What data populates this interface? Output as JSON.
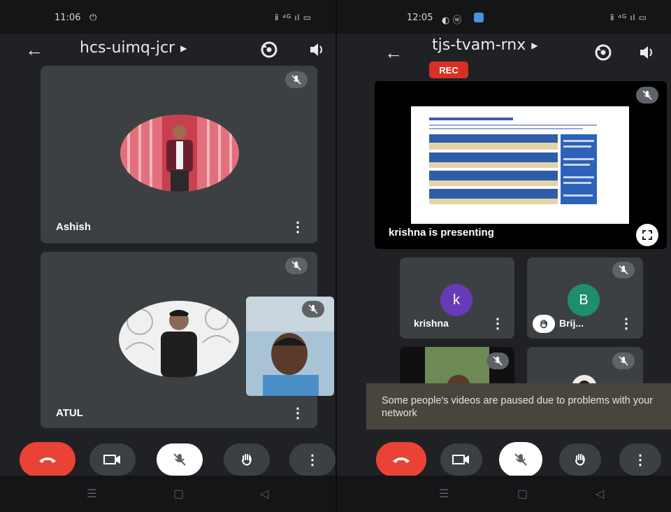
{
  "left": {
    "status": {
      "time": "11:06",
      "indicators": "⏻",
      "signal": "ⅱ ⁴ᴳ ıl ▭"
    },
    "meeting_code": "hcs-uimq-jcr",
    "participants": [
      {
        "name": "Ashish"
      },
      {
        "name": "ATUL"
      }
    ],
    "controls": [
      "end-call",
      "camera",
      "mic-off",
      "raise-hand",
      "more"
    ]
  },
  "right": {
    "status": {
      "time": "12:05",
      "indicators": "◐ ⓦ",
      "signal": "ⅱ ⁴ᴳ ıl ▭"
    },
    "meeting_code": "tjs-tvam-rnx",
    "rec_label": "REC",
    "presenting_label": "krishna is presenting",
    "participants": [
      {
        "name": "krishna",
        "initial": "k",
        "color": "#673ab7"
      },
      {
        "name": "Brij...",
        "initial": "B",
        "color": "#1e8e6e"
      }
    ],
    "toast": "Some people's videos are paused due to problems with your network",
    "controls": [
      "end-call",
      "camera",
      "mic-off",
      "raise-hand",
      "more"
    ]
  },
  "nav": [
    "☰",
    "▢",
    "◁"
  ],
  "colors": {
    "accent_red": "#ea4335",
    "tile": "#3c4043",
    "bg": "#202124"
  }
}
